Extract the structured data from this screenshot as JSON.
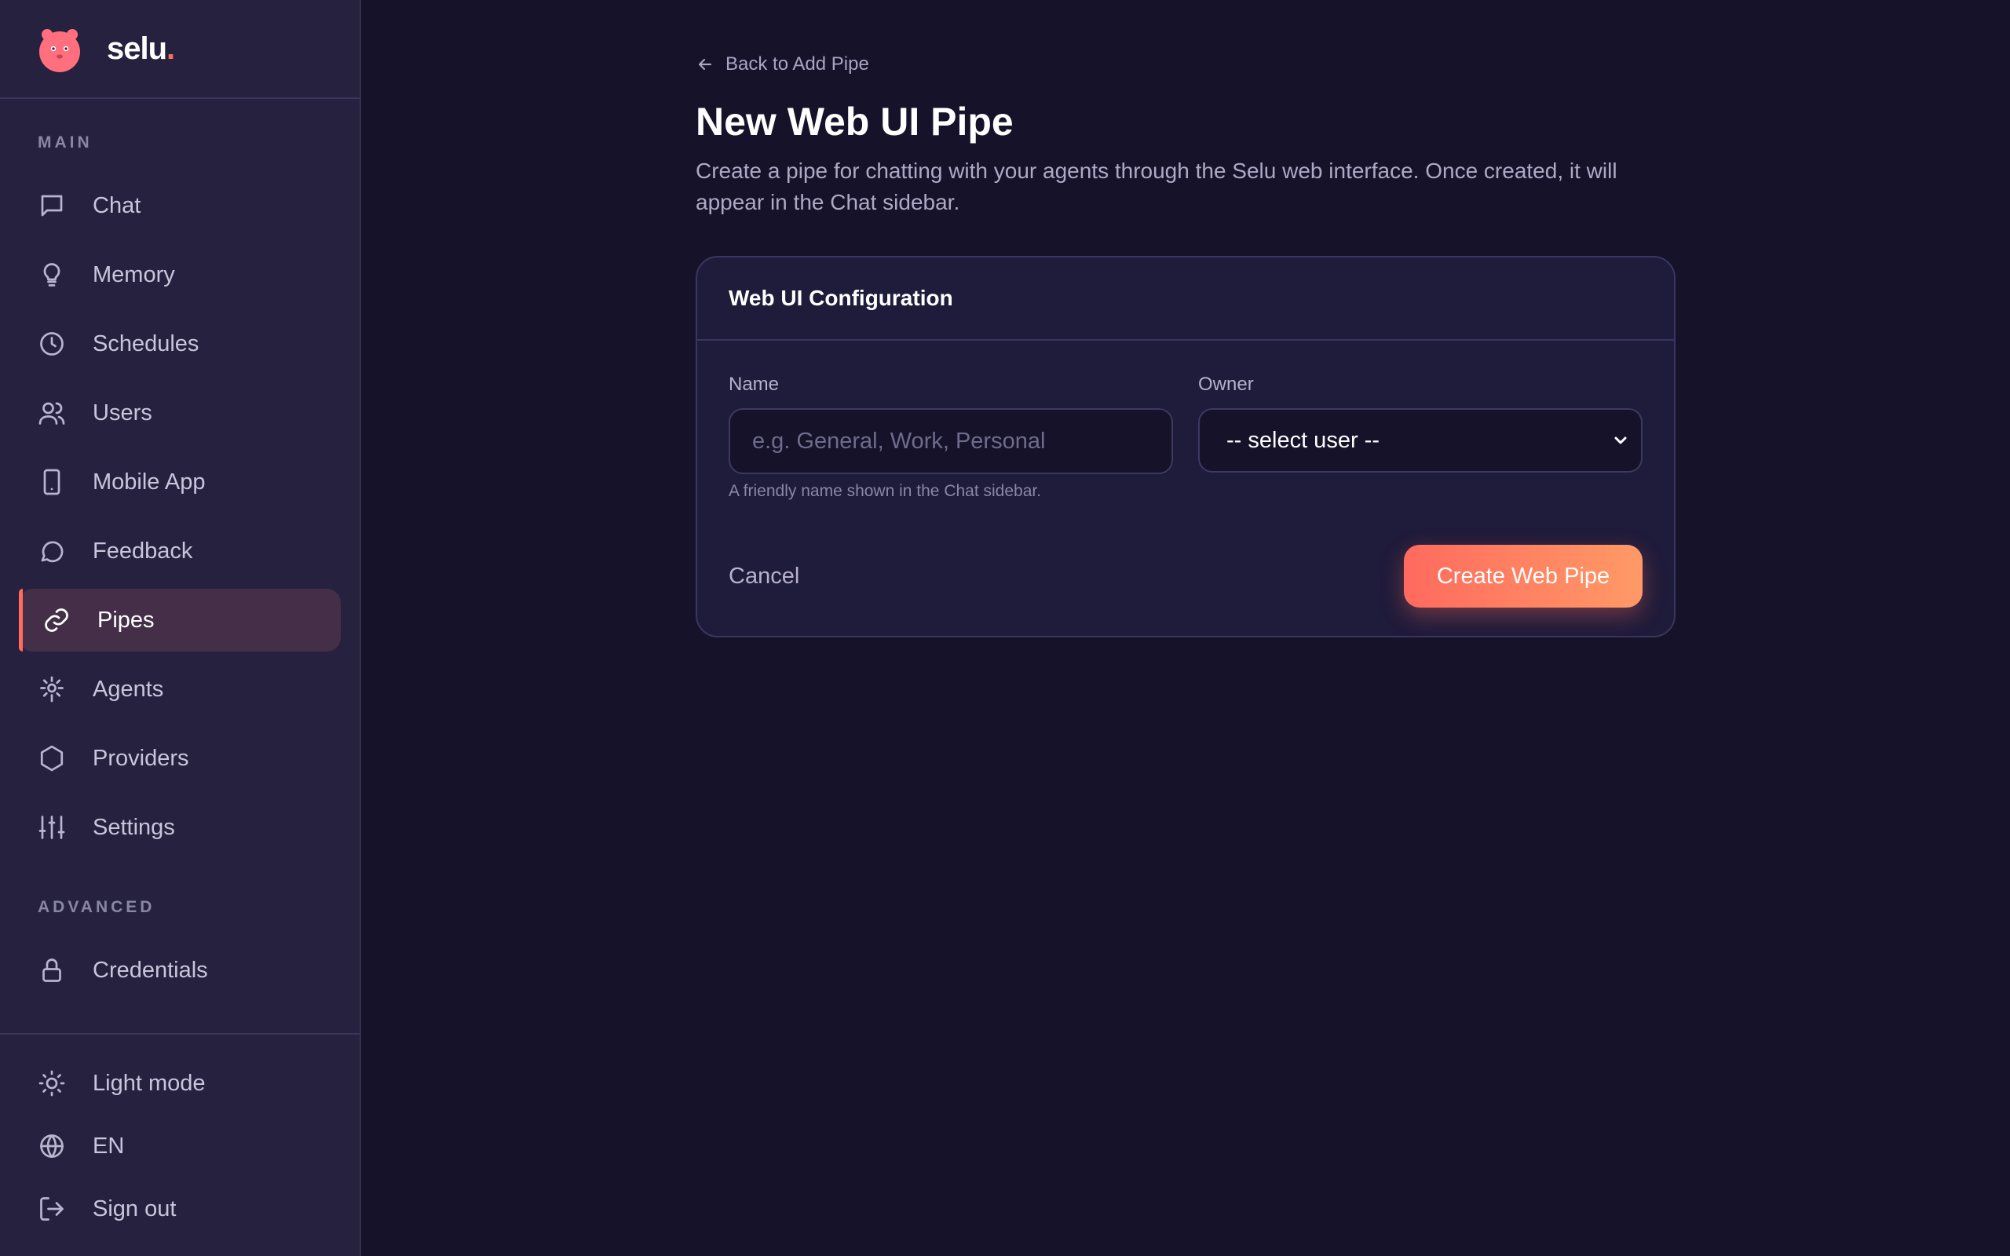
{
  "brand": {
    "name": "selu",
    "dot": "."
  },
  "sidebar": {
    "sections": {
      "main": "MAIN",
      "advanced": "ADVANCED"
    },
    "main_items": [
      {
        "label": "Chat",
        "icon": "chat-icon"
      },
      {
        "label": "Memory",
        "icon": "lightbulb-icon"
      },
      {
        "label": "Schedules",
        "icon": "clock-icon"
      },
      {
        "label": "Users",
        "icon": "users-icon"
      },
      {
        "label": "Mobile App",
        "icon": "phone-icon"
      },
      {
        "label": "Feedback",
        "icon": "feedback-icon"
      },
      {
        "label": "Pipes",
        "icon": "link-icon",
        "active": true
      },
      {
        "label": "Agents",
        "icon": "agents-icon"
      },
      {
        "label": "Providers",
        "icon": "hexagon-icon"
      },
      {
        "label": "Settings",
        "icon": "sliders-icon"
      }
    ],
    "advanced_items": [
      {
        "label": "Credentials",
        "icon": "lock-icon"
      }
    ],
    "footer_items": [
      {
        "label": "Light mode",
        "icon": "sun-icon"
      },
      {
        "label": "EN",
        "icon": "globe-icon"
      },
      {
        "label": "Sign out",
        "icon": "sign-out-icon"
      }
    ]
  },
  "main": {
    "back_link": "Back to Add Pipe",
    "title": "New Web UI Pipe",
    "description": "Create a pipe for chatting with your agents through the Selu web interface. Once created, it will appear in the Chat sidebar.",
    "card": {
      "title": "Web UI Configuration",
      "name_label": "Name",
      "name_value": "",
      "name_placeholder": "e.g. General, Work, Personal",
      "name_hint": "A friendly name shown in the Chat sidebar.",
      "owner_label": "Owner",
      "owner_selected": "-- select user --",
      "cancel_label": "Cancel",
      "submit_label": "Create Web Pipe"
    }
  },
  "colors": {
    "accent": "#ff6b5c",
    "accent_gradient_end": "#ff9a66",
    "sidebar_bg": "#25213f",
    "page_bg": "#15122a",
    "active_item_bg": "#452f48"
  }
}
